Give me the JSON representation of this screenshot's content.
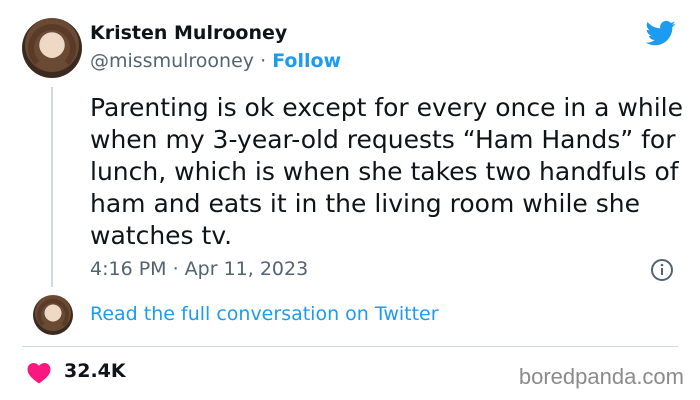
{
  "author": {
    "name": "Kristen Mulrooney",
    "handle": "@missmulrooney",
    "separator": "·",
    "follow_label": "Follow"
  },
  "tweet": {
    "text": "Parenting is ok except for every once in a while when my 3-year-old requests “Ham Hands” for lunch, which is when she takes two handfuls of ham and eats it in the living room while she watches tv.",
    "time": "4:16 PM · Apr 11, 2023"
  },
  "conversation_link": "Read the full conversation on Twitter",
  "engagement": {
    "likes": "32.4K"
  },
  "watermark": "boredpanda.com",
  "colors": {
    "accent": "#1d9bf0",
    "heart": "#f91880",
    "text": "#0f1419",
    "muted": "#536471"
  },
  "icons": {
    "brand": "twitter-bird-icon",
    "info": "info-icon",
    "like": "heart-icon"
  }
}
